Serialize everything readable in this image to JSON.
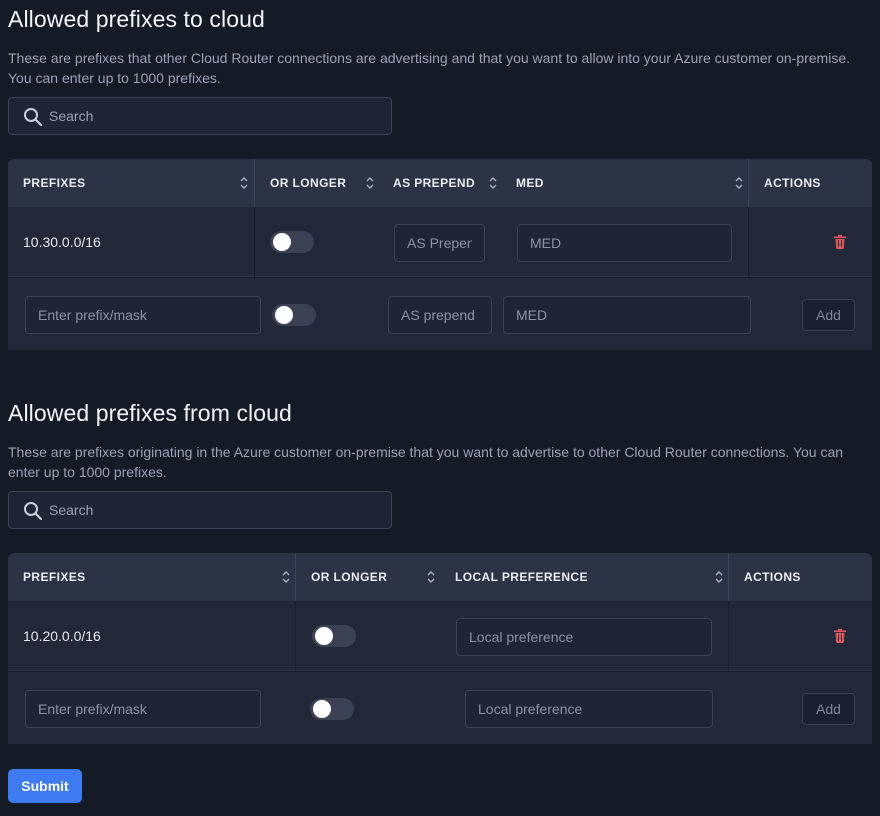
{
  "to_cloud": {
    "title": "Allowed prefixes to cloud",
    "description": "These are prefixes that other Cloud Router connections are advertising and that you want to allow into your Azure customer on-premise. You can enter up to 1000 prefixes.",
    "search_placeholder": "Search",
    "columns": {
      "prefixes": "PREFIXES",
      "or_longer": "OR LONGER",
      "as_prepend": "AS PREPEND",
      "med": "MED",
      "actions": "ACTIONS"
    },
    "rows": [
      {
        "prefix": "10.30.0.0/16",
        "or_longer": false,
        "as_prepend_placeholder": "AS Prepend",
        "med_placeholder": "MED"
      }
    ],
    "new_row": {
      "prefix_placeholder": "Enter prefix/mask",
      "or_longer": false,
      "as_prepend_placeholder": "AS prepend",
      "med_placeholder": "MED",
      "add_label": "Add"
    }
  },
  "from_cloud": {
    "title": "Allowed prefixes from cloud",
    "description": "These are prefixes originating in the Azure customer on-premise that you want to advertise to other Cloud Router connections. You can enter up to 1000 prefixes.",
    "search_placeholder": "Search",
    "columns": {
      "prefixes": "PREFIXES",
      "or_longer": "OR LONGER",
      "local_preference": "LOCAL PREFERENCE",
      "actions": "ACTIONS"
    },
    "rows": [
      {
        "prefix": "10.20.0.0/16",
        "or_longer": false,
        "local_preference_placeholder": "Local preference"
      }
    ],
    "new_row": {
      "prefix_placeholder": "Enter prefix/mask",
      "or_longer": false,
      "local_preference_placeholder": "Local preference",
      "add_label": "Add"
    }
  },
  "submit_label": "Submit",
  "colors": {
    "background": "#151a27",
    "header": "#2c3344",
    "row": "#222838",
    "accent": "#3e7bf0",
    "danger": "#e0585f"
  }
}
